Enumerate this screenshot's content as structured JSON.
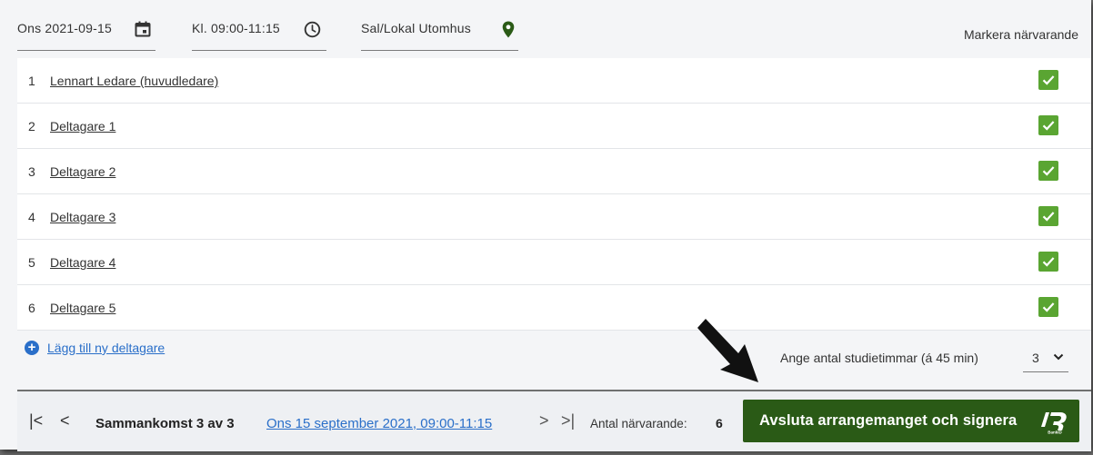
{
  "header": {
    "date": "Ons 2021-09-15",
    "time": "Kl. 09:00-11:15",
    "location": "Sal/Lokal Utomhus",
    "mark_attendance_label": "Markera närvarande"
  },
  "participants": [
    {
      "num": "1",
      "name": "Lennart Ledare (huvudledare)",
      "present": true
    },
    {
      "num": "2",
      "name": "Deltagare 1",
      "present": true
    },
    {
      "num": "3",
      "name": "Deltagare 2",
      "present": true
    },
    {
      "num": "4",
      "name": "Deltagare 3",
      "present": true
    },
    {
      "num": "5",
      "name": "Deltagare 4",
      "present": true
    },
    {
      "num": "6",
      "name": "Deltagare 5",
      "present": true
    }
  ],
  "add_participant_label": "Lägg till ny deltagare",
  "study_hours": {
    "label": "Ange antal studietimmar (á 45 min)",
    "value": "3"
  },
  "footer": {
    "first_icon": "|<",
    "prev_icon": "<",
    "next_icon": ">",
    "last_icon": ">|",
    "session_label": "Sammankomst 3 av 3",
    "session_date_link": "Ons 15 september 2021, 09:00-11:15",
    "attendance_label": "Antal närvarande:",
    "attendance_count": "6",
    "finish_button_label": "Avsluta arrangemanget och signera"
  },
  "colors": {
    "accent_green": "#2a5a16",
    "checkbox_green": "#5aa532",
    "link_blue": "#2a6fc9"
  }
}
